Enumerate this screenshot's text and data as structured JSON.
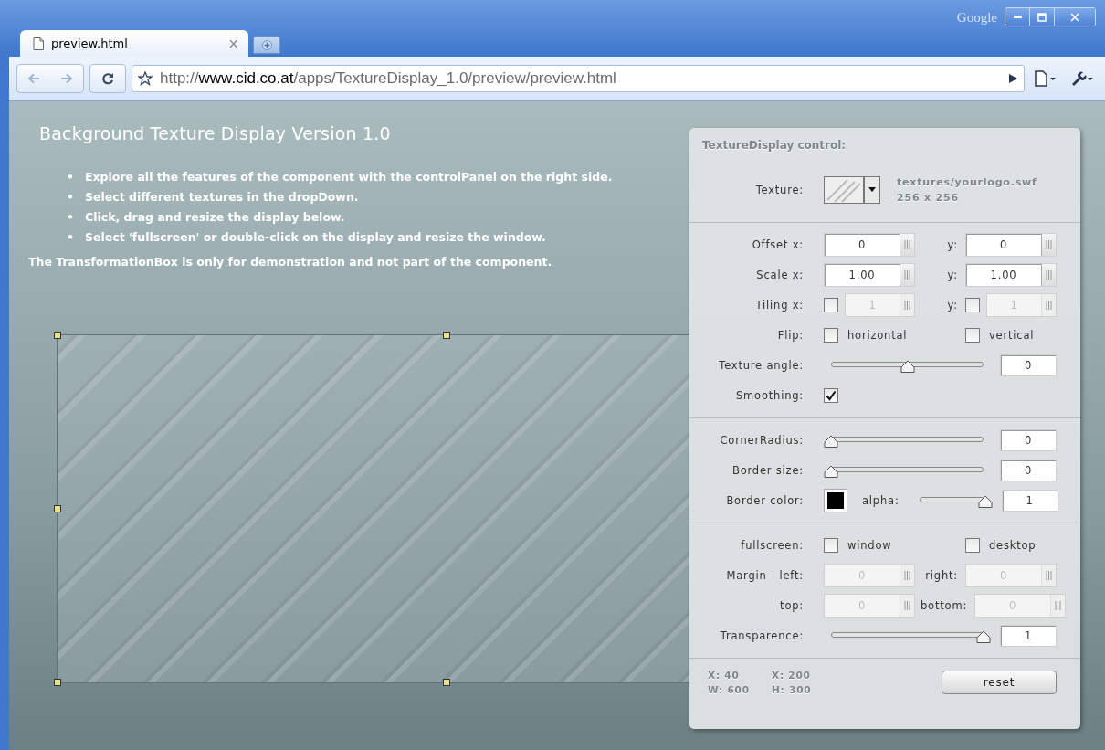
{
  "browser": {
    "brand": "Google",
    "tab": {
      "title": "preview.html",
      "close": "×",
      "selected": true
    },
    "url": {
      "scheme": "http://",
      "host": "www.cid.co.at",
      "path": "/apps/TextureDisplay_1.0/preview/preview.html"
    }
  },
  "page": {
    "title": "Background Texture Display Version 1.0",
    "bullets": [
      {
        "marker": "•",
        "text": "Explore all the features of the component with the controlPanel on the right side."
      },
      {
        "marker": "•",
        "text": "Select different textures in the dropDown."
      },
      {
        "marker": "•",
        "text": "Click, drag and resize the display below."
      },
      {
        "marker": "•",
        "text": "Select 'fullscreen' or double-click on the display and resize the window."
      }
    ],
    "note": "The TransformationBox is only for demonstration and not part of the component."
  },
  "panel": {
    "title": "TextureDisplay control:",
    "texture": {
      "label": "Texture:",
      "file": "textures/yourlogo.swf",
      "size": "256 x 256"
    },
    "sections": [
      [
        {
          "kind": "numbers",
          "label": "Offset x:",
          "fields": [
            {
              "value": "0",
              "disabled": false
            },
            {
              "label": "y:",
              "value": "0",
              "disabled": false
            }
          ]
        },
        {
          "kind": "numbers",
          "label": "Scale x:",
          "fields": [
            {
              "value": "1.00",
              "disabled": false
            },
            {
              "label": "y:",
              "value": "1.00",
              "disabled": false
            }
          ]
        },
        {
          "kind": "numbers",
          "label": "Tiling x:",
          "fields": [
            {
              "checked": false,
              "value": "1",
              "disabled": true
            },
            {
              "label": "y:",
              "checked": false,
              "value": "1",
              "disabled": true
            }
          ]
        },
        {
          "kind": "options",
          "label": "Flip:",
          "options": [
            {
              "label": "horizontal",
              "checked": false
            },
            {
              "label": "vertical",
              "checked": false
            }
          ]
        },
        {
          "kind": "slider",
          "label": "Texture angle:",
          "level": 0.5,
          "value": "0"
        },
        {
          "kind": "check",
          "label": "Smoothing:",
          "checked": true
        }
      ],
      [
        {
          "kind": "slider",
          "label": "CornerRadius:",
          "level": 0,
          "value": "0"
        },
        {
          "kind": "slider",
          "label": "Border size:",
          "level": 0,
          "value": "0"
        },
        {
          "kind": "color",
          "label": "Border color:",
          "color": "#000000",
          "alpha_label": "alpha:",
          "level": 1,
          "value": "1"
        }
      ],
      [
        {
          "kind": "options",
          "label": "fullscreen:",
          "options": [
            {
              "label": "window",
              "checked": false
            },
            {
              "label": "desktop",
              "checked": false
            }
          ]
        },
        {
          "kind": "numbers",
          "label": "Margin - left:",
          "fields": [
            {
              "value": "0",
              "disabled": true
            },
            {
              "label": "right:",
              "value": "0",
              "disabled": true
            }
          ]
        },
        {
          "kind": "numbers",
          "label": "top:",
          "fields": [
            {
              "value": "0",
              "disabled": true
            },
            {
              "label": "bottom:",
              "value": "0",
              "disabled": true
            }
          ]
        },
        {
          "kind": "slider",
          "label": "Transparence:",
          "level": 1,
          "value": "1"
        }
      ]
    ],
    "footer": {
      "coords": [
        "X: 40",
        "X: 200",
        "W: 600",
        "H: 300"
      ],
      "reset": "reset"
    }
  }
}
